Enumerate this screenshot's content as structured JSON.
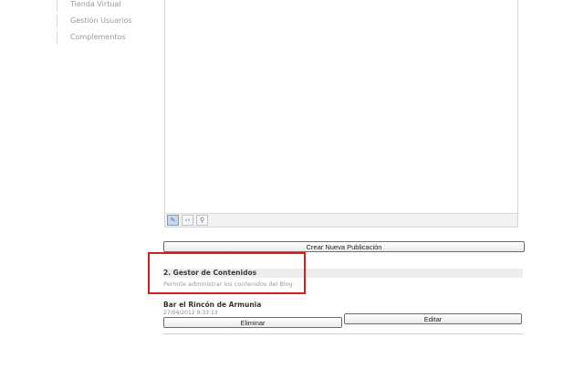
{
  "sidebar": {
    "items": [
      {
        "label": "Tienda Virtual"
      },
      {
        "label": "Gestión Usuarios"
      },
      {
        "label": "Complementos"
      }
    ]
  },
  "editor": {
    "toolbar": [
      {
        "icon": "pencil-icon",
        "glyph": "✎"
      },
      {
        "icon": "code-icon",
        "glyph": "‹›"
      },
      {
        "icon": "magnifier-icon",
        "glyph": "⚲"
      }
    ]
  },
  "actions": {
    "create_label": "Crear Nueva Publicación"
  },
  "section": {
    "title": "2. Gestor de Contenidos",
    "description": "Permite administrar los contenidos del Blog"
  },
  "post": {
    "title": "Bar el Rincón de Armunia",
    "date": "27/04/2012 9:33:13",
    "delete_label": "Eliminar",
    "edit_label": "Editar"
  },
  "colors": {
    "highlight": "#d02020",
    "sidebar_text": "#9a9a9a"
  }
}
